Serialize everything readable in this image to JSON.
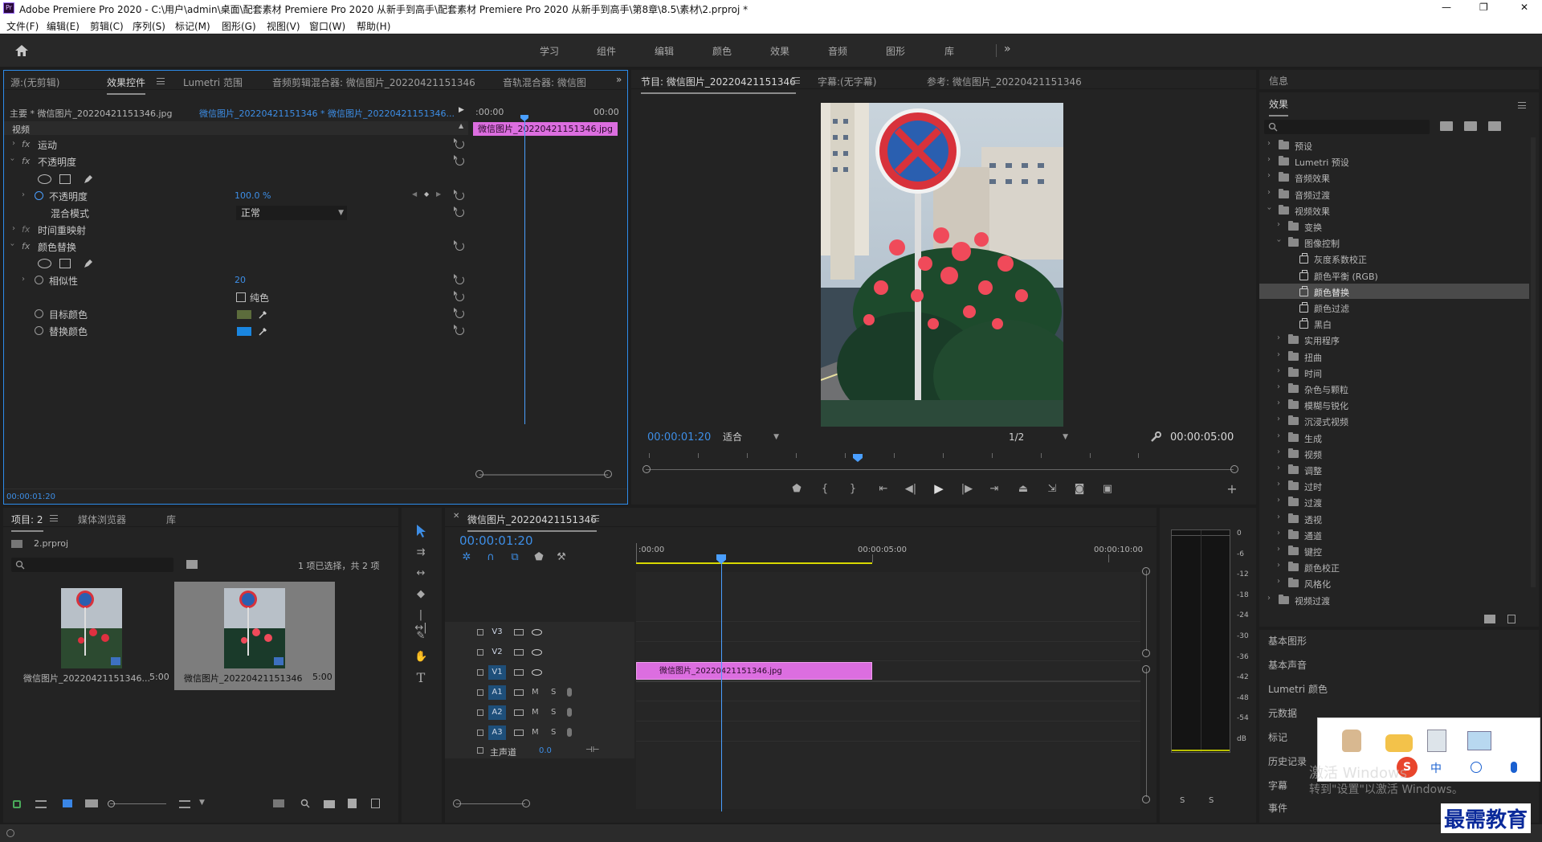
{
  "titlebar": {
    "title": "Adobe Premiere Pro 2020 - C:\\用户\\admin\\桌面\\配套素材 Premiere Pro 2020 从新手到高手\\配套素材 Premiere Pro 2020 从新手到高手\\第8章\\8.5\\素材\\2.prproj *",
    "minimize": "—",
    "maximize": "❐",
    "close": "✕"
  },
  "menubar": [
    "文件(F)",
    "编辑(E)",
    "剪辑(C)",
    "序列(S)",
    "标记(M)",
    "图形(G)",
    "视图(V)",
    "窗口(W)",
    "帮助(H)"
  ],
  "workspaces": [
    "学习",
    "组件",
    "编辑",
    "颜色",
    "效果",
    "音频",
    "图形",
    "库"
  ],
  "workspace_more": "»",
  "effect_controls": {
    "tabs": [
      "源:(无剪辑)",
      "效果控件",
      "Lumetri 范围",
      "音频剪辑混合器: 微信图片_20220421151346",
      "音轨混合器: 微信图"
    ],
    "master": "主要 * 微信图片_20220421151346.jpg",
    "sequence_clip": "微信图片_20220421151346 * 微信图片_20220421151346...",
    "video_label": "视频",
    "mini_time_start": ":00:00",
    "mini_time_end": "00:00",
    "mini_clip": "微信图片_20220421151346.jpg",
    "motion": "运动",
    "opacity": "不透明度",
    "opacity_prop": "不透明度",
    "opacity_value": "100.0 %",
    "blend_mode_label": "混合模式",
    "blend_mode_value": "正常",
    "time_remap": "时间重映射",
    "color_replace": "颜色替换",
    "similarity": "相似性",
    "similarity_value": "20",
    "solid": "纯色",
    "target_color": "目标颜色",
    "replace_color": "替换颜色",
    "target_color_hex": "#5c6c3c",
    "replace_color_hex": "#1a86e0",
    "fx": "fx",
    "timecode": "00:00:01:20"
  },
  "program": {
    "tabs": [
      "节目: 微信图片_20220421151346",
      "字幕:(无字幕)",
      "参考: 微信图片_20220421151346"
    ],
    "timecode": "00:00:01:20",
    "fit": "适合",
    "resolution": "1/2",
    "duration": "00:00:05:00"
  },
  "project": {
    "tabs": [
      "项目: 2",
      "媒体浏览器",
      "库"
    ],
    "file": "2.prproj",
    "selection_info": "1 项已选择，共 2 项",
    "items": [
      {
        "name": "微信图片_20220421151346...",
        "duration": "5:00"
      },
      {
        "name": "微信图片_20220421151346",
        "duration": "5:00"
      }
    ]
  },
  "timeline": {
    "tab": "微信图片_20220421151346",
    "timecode": "00:00:01:20",
    "ruler": [
      ":00:00",
      "00:00:05:00",
      "00:00:10:00"
    ],
    "video_tracks": [
      "V3",
      "V2",
      "V1"
    ],
    "audio_tracks": [
      "A1",
      "A2",
      "A3"
    ],
    "master": "主声道",
    "master_value": "0.0",
    "clip": "微信图片_20220421151346.jpg",
    "m": "M",
    "s": "S"
  },
  "meter": {
    "ticks": [
      "0",
      "-6",
      "-12",
      "-18",
      "-24",
      "-30",
      "-36",
      "-42",
      "-48",
      "-54",
      "dB"
    ],
    "solo": [
      "S",
      "S"
    ]
  },
  "info_tab": "信息",
  "effects": {
    "title": "效果",
    "tree": [
      {
        "label": "预设",
        "level": 0,
        "type": "folder",
        "open": false
      },
      {
        "label": "Lumetri 预设",
        "level": 0,
        "type": "folder",
        "open": false
      },
      {
        "label": "音频效果",
        "level": 0,
        "type": "folder",
        "open": false
      },
      {
        "label": "音频过渡",
        "level": 0,
        "type": "folder",
        "open": false
      },
      {
        "label": "视频效果",
        "level": 0,
        "type": "folder",
        "open": true
      },
      {
        "label": "变换",
        "level": 1,
        "type": "folder",
        "open": false
      },
      {
        "label": "图像控制",
        "level": 1,
        "type": "folder",
        "open": true
      },
      {
        "label": "灰度系数校正",
        "level": 2,
        "type": "fx"
      },
      {
        "label": "颜色平衡 (RGB)",
        "level": 2,
        "type": "fx"
      },
      {
        "label": "颜色替换",
        "level": 2,
        "type": "fx",
        "selected": true
      },
      {
        "label": "颜色过滤",
        "level": 2,
        "type": "fx"
      },
      {
        "label": "黑白",
        "level": 2,
        "type": "fx"
      },
      {
        "label": "实用程序",
        "level": 1,
        "type": "folder",
        "open": false
      },
      {
        "label": "扭曲",
        "level": 1,
        "type": "folder",
        "open": false
      },
      {
        "label": "时间",
        "level": 1,
        "type": "folder",
        "open": false
      },
      {
        "label": "杂色与颗粒",
        "level": 1,
        "type": "folder",
        "open": false
      },
      {
        "label": "模糊与锐化",
        "level": 1,
        "type": "folder",
        "open": false
      },
      {
        "label": "沉浸式视频",
        "level": 1,
        "type": "folder",
        "open": false
      },
      {
        "label": "生成",
        "level": 1,
        "type": "folder",
        "open": false
      },
      {
        "label": "视频",
        "level": 1,
        "type": "folder",
        "open": false
      },
      {
        "label": "调整",
        "level": 1,
        "type": "folder",
        "open": false
      },
      {
        "label": "过时",
        "level": 1,
        "type": "folder",
        "open": false
      },
      {
        "label": "过渡",
        "level": 1,
        "type": "folder",
        "open": false
      },
      {
        "label": "透视",
        "level": 1,
        "type": "folder",
        "open": false
      },
      {
        "label": "通道",
        "level": 1,
        "type": "folder",
        "open": false
      },
      {
        "label": "键控",
        "level": 1,
        "type": "folder",
        "open": false
      },
      {
        "label": "颜色校正",
        "level": 1,
        "type": "folder",
        "open": false
      },
      {
        "label": "风格化",
        "level": 1,
        "type": "folder",
        "open": false
      },
      {
        "label": "视频过渡",
        "level": 0,
        "type": "folder",
        "open": false
      }
    ]
  },
  "right_panels": [
    "基本图形",
    "基本声音",
    "Lumetri 颜色",
    "元数据",
    "标记",
    "历史记录",
    "字幕",
    "事件"
  ],
  "overlay": {
    "activate_title": "激活 Windows",
    "activate_sub": "转到\"设置\"以激活 Windows。",
    "ime": "中",
    "watermark": "最需教育",
    "sogou": "S"
  }
}
